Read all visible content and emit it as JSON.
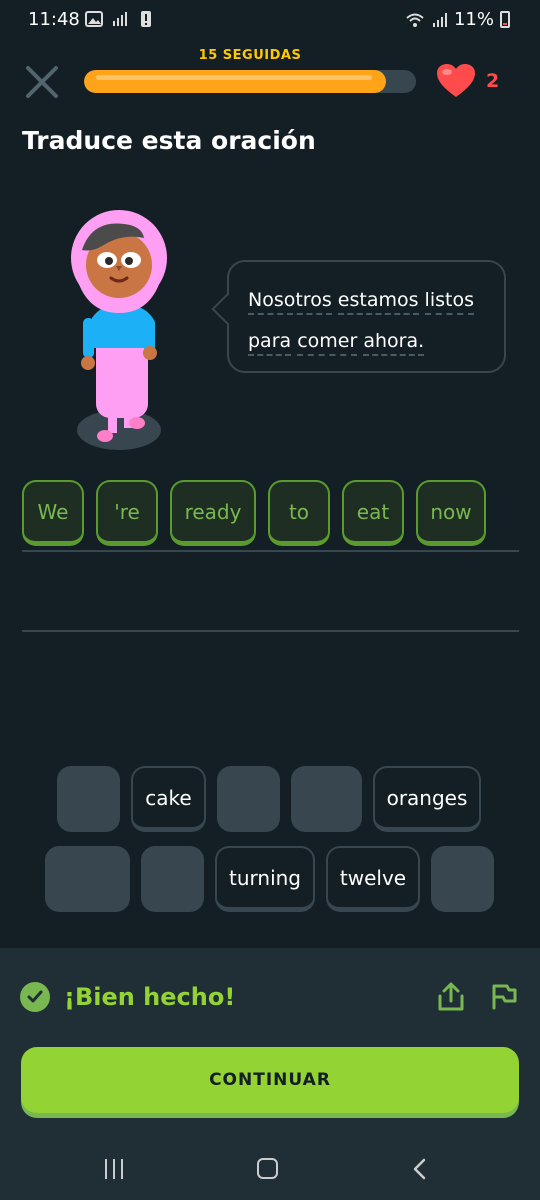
{
  "status_bar": {
    "time": "11:48",
    "battery": "11%",
    "icons": [
      "gallery-icon",
      "data-signal-icon",
      "alert-icon",
      "wifi-icon",
      "signal-icon",
      "battery-icon"
    ]
  },
  "header": {
    "streak_label": "15 SEGUIDAS",
    "progress_fraction": 0.91,
    "hearts": "2",
    "close_icon": "close-icon",
    "heart_icon": "heart-icon"
  },
  "title": "Traduce esta oración",
  "prompt": {
    "words": [
      "Nosotros",
      "estamos",
      "listos",
      "para",
      "comer",
      "ahora."
    ]
  },
  "answer": {
    "chips": [
      "We",
      "'re",
      "ready",
      "to",
      "eat",
      "now"
    ]
  },
  "word_bank": {
    "row1": [
      {
        "text": "",
        "used": true
      },
      {
        "text": "cake",
        "used": false
      },
      {
        "text": "",
        "used": true
      },
      {
        "text": "",
        "used": true
      },
      {
        "text": "oranges",
        "used": false
      }
    ],
    "row2": [
      {
        "text": "",
        "used": true
      },
      {
        "text": "",
        "used": true
      },
      {
        "text": "turning",
        "used": false
      },
      {
        "text": "twelve",
        "used": false
      },
      {
        "text": "",
        "used": true
      }
    ]
  },
  "feedback": {
    "message": "¡Bien hecho!",
    "continue_label": "CONTINUAR"
  },
  "colors": {
    "background": "#131f24",
    "footer": "#202f36",
    "accent_green": "#93d333",
    "streak_orange": "#ffa319",
    "heart_red": "#ff4b4b"
  }
}
